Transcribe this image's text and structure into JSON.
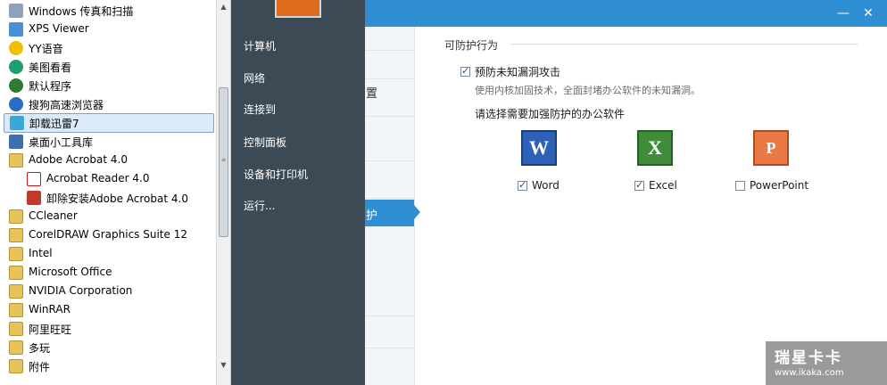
{
  "start_menu": {
    "programs": [
      {
        "label": "Windows 传真和扫描",
        "icon": "fax-icon",
        "sub": false,
        "selected": false
      },
      {
        "label": "XPS Viewer",
        "icon": "xps-viewer-icon",
        "sub": false,
        "selected": false
      },
      {
        "label": "YY语音",
        "icon": "yy-voice-icon",
        "sub": false,
        "selected": false
      },
      {
        "label": "美图看看",
        "icon": "meitu-viewer-icon",
        "sub": false,
        "selected": false
      },
      {
        "label": "默认程序",
        "icon": "default-programs-icon",
        "sub": false,
        "selected": false
      },
      {
        "label": "搜狗高速浏览器",
        "icon": "sogou-browser-icon",
        "sub": false,
        "selected": false
      },
      {
        "label": "卸载迅雷7",
        "icon": "uninstall-thunder-icon",
        "sub": false,
        "selected": true
      },
      {
        "label": "桌面小工具库",
        "icon": "desktop-gadgets-icon",
        "sub": false,
        "selected": false
      },
      {
        "label": "Adobe Acrobat 4.0",
        "icon": "folder-icon",
        "sub": false,
        "selected": false
      },
      {
        "label": "Acrobat Reader 4.0",
        "icon": "acrobat-reader-icon",
        "sub": true,
        "selected": false
      },
      {
        "label": "卸除安装Adobe Acrobat 4.0",
        "icon": "uninstall-acrobat-icon",
        "sub": true,
        "selected": false
      },
      {
        "label": "CCleaner",
        "icon": "folder-icon",
        "sub": false,
        "selected": false
      },
      {
        "label": "CorelDRAW Graphics Suite 12",
        "icon": "folder-icon",
        "sub": false,
        "selected": false
      },
      {
        "label": "Intel",
        "icon": "folder-icon",
        "sub": false,
        "selected": false
      },
      {
        "label": "Microsoft Office",
        "icon": "folder-icon",
        "sub": false,
        "selected": false
      },
      {
        "label": "NVIDIA Corporation",
        "icon": "folder-icon",
        "sub": false,
        "selected": false
      },
      {
        "label": "WinRAR",
        "icon": "folder-icon",
        "sub": false,
        "selected": false
      },
      {
        "label": "阿里旺旺",
        "icon": "folder-icon",
        "sub": false,
        "selected": false
      },
      {
        "label": "多玩",
        "icon": "folder-icon",
        "sub": false,
        "selected": false
      },
      {
        "label": "附件",
        "icon": "folder-icon",
        "sub": false,
        "selected": false
      }
    ],
    "places": [
      {
        "label": "计算机"
      },
      {
        "label": "网络"
      },
      {
        "label": "连接到"
      },
      {
        "label": "控制面板"
      },
      {
        "label": "设备和打印机"
      },
      {
        "label": "运行..."
      }
    ]
  },
  "app": {
    "nav_fragment_1": "置",
    "nav_fragment_2": "护",
    "section_title": "可防护行为",
    "exploit_option": {
      "label": "预防未知漏洞攻击",
      "checked": true,
      "description": "使用内核加固技术，全面封堵办公软件的未知漏洞。"
    },
    "select_prompt": "请选择需要加强防护的办公软件",
    "office_apps": [
      {
        "label": "Word",
        "checked": true,
        "glyph": "W"
      },
      {
        "label": "Excel",
        "checked": true,
        "glyph": "X"
      },
      {
        "label": "PowerPoint",
        "checked": false,
        "glyph": "P"
      }
    ],
    "window_controls": {
      "minimize": "—",
      "close": "✕"
    }
  },
  "watermark": {
    "main": "瑞星卡卡",
    "url": "www.ikaka.com"
  },
  "colors": {
    "accent": "#2f8fd2",
    "start_dark": "#3c4a55",
    "selection": "#dbeaf9"
  }
}
